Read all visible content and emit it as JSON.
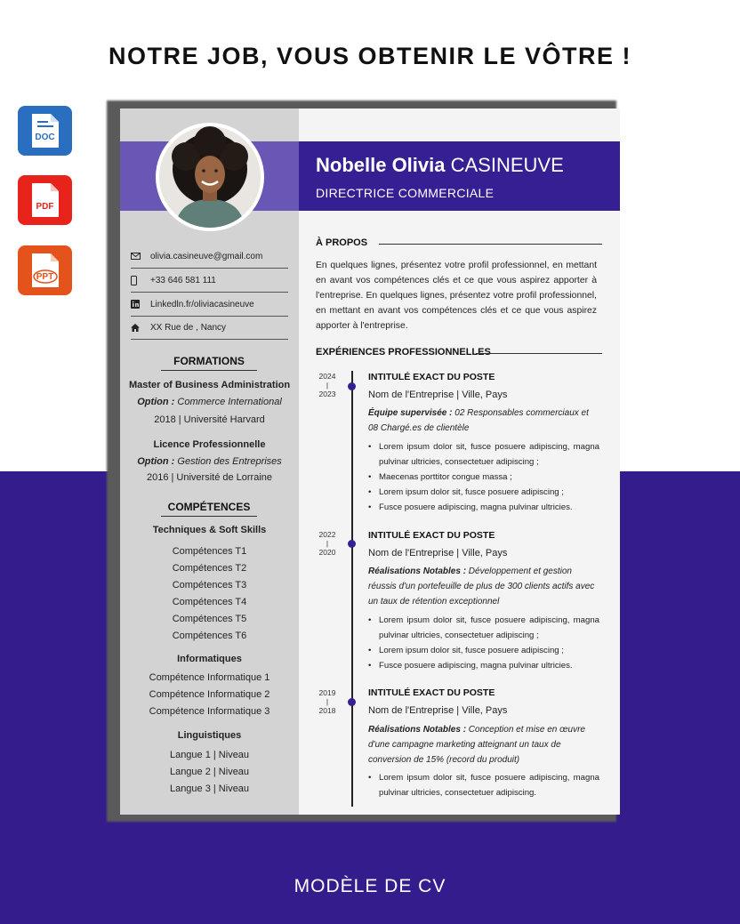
{
  "headline": "NOTRE JOB, VOUS OBTENIR LE VÔTRE !",
  "footer": "MODÈLE DE CV",
  "file_buttons": [
    {
      "label": "DOC",
      "color": "#2a6fbf",
      "icon": "doc-file-icon"
    },
    {
      "label": "PDF",
      "color": "#e8231c",
      "icon": "pdf-file-icon"
    },
    {
      "label": "PPT",
      "color": "#e5531d",
      "icon": "ppt-file-icon"
    }
  ],
  "colors": {
    "accent": "#361e93",
    "accent_light": "#6a56b4",
    "sidebar": "#d3d3d3",
    "background_bottom": "#351c8c"
  },
  "cv": {
    "first_name": "Nobelle Olivia",
    "last_name": "CASINEUVE",
    "job_title": "DIRECTRICE COMMERCIALE",
    "contacts": [
      {
        "icon": "email-icon",
        "text": "olivia.casineuve@gmail.com"
      },
      {
        "icon": "phone-icon",
        "text": "+33 646 581 111"
      },
      {
        "icon": "linkedin-icon",
        "text": "Linkedln.fr/oliviacasineuve"
      },
      {
        "icon": "home-icon",
        "text": "XX Rue de , Nancy"
      }
    ],
    "formations": {
      "heading": "FORMATIONS",
      "items": [
        {
          "degree": "Master of Business Administration",
          "option_label": "Option :",
          "option": " Commerce International",
          "detail": "2018  |  Université Harvard"
        },
        {
          "degree": "Licence Professionnelle",
          "option_label": "Option :",
          "option": " Gestion des Entreprises",
          "detail": "2016  |  Université de Lorraine"
        }
      ]
    },
    "competences": {
      "heading": "COMPÉTENCES",
      "groups": [
        {
          "title": "Techniques & Soft Skills",
          "items": [
            "Compétences T1",
            "Compétences T2",
            "Compétences T3",
            "Compétences T4",
            "Compétences T5",
            "Compétences T6"
          ]
        },
        {
          "title": "Informatiques",
          "items": [
            "Compétence Informatique 1",
            "Compétence Informatique 2",
            "Compétence Informatique 3"
          ]
        },
        {
          "title": "Linguistiques",
          "items": [
            "Langue 1  |  Niveau",
            "Langue 2  |  Niveau",
            "Langue 3  |  Niveau"
          ]
        }
      ]
    },
    "about": {
      "heading": "À PROPOS",
      "text": "En quelques lignes, présentez votre profil professionnel, en mettant en avant vos compétences clés et ce que vous aspirez apporter à l'entreprise. En quelques lignes, présentez votre profil professionnel, en mettant en avant vos compétences clés et ce que vous aspirez apporter à l'entreprise."
    },
    "experience": {
      "heading": "EXPÉRIENCES  PROFESSIONNELLES",
      "jobs": [
        {
          "year_end": "2024",
          "sep": "|",
          "year_start": "2023",
          "title": "INTITULÉ EXACT DU POSTE",
          "company": "Nom de l'Entreprise  |  Ville, Pays",
          "detail_label": "Équipe supervisée :",
          "detail": " 02 Responsables commerciaux et 08 Chargé.es de clientèle",
          "bullets": [
            "Lorem ipsum dolor sit, fusce posuere adipiscing, magna pulvinar ultricies, consectetuer adipiscing ;",
            "Maecenas porttitor congue massa ;",
            "Lorem ipsum dolor sit, fusce posuere adipiscing ;",
            "Fusce posuere adipiscing, magna pulvinar ultricies."
          ]
        },
        {
          "year_end": "2022",
          "sep": "|",
          "year_start": "2020",
          "title": "INTITULÉ EXACT DU POSTE",
          "company": "Nom de l'Entreprise  |  Ville, Pays",
          "detail_label": "Réalisations Notables :",
          "detail": " Développement et gestion réussis d'un portefeuille de plus de 300 clients actifs avec un taux de rétention exceptionnel",
          "bullets": [
            "Lorem ipsum dolor sit, fusce posuere adipiscing, magna pulvinar ultricies, consectetuer adipiscing ;",
            "Lorem ipsum dolor sit, fusce posuere adipiscing ;",
            "Fusce posuere adipiscing, magna pulvinar ultricies."
          ]
        },
        {
          "year_end": "2019",
          "sep": "|",
          "year_start": "2018",
          "title": "INTITULÉ EXACT DU POSTE",
          "company": "Nom de l'Entreprise  |  Ville, Pays",
          "detail_label": "Réalisations Notables :",
          "detail": " Conception et mise en œuvre d'une campagne marketing atteignant un taux de conversion de 15% (record du produit)",
          "bullets": [
            "Lorem ipsum dolor sit, fusce posuere adipiscing, magna pulvinar ultricies, consectetuer adipiscing."
          ]
        }
      ]
    }
  }
}
